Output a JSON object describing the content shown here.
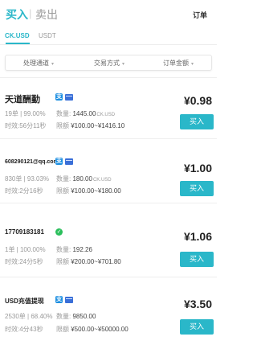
{
  "header": {
    "tab_buy": "买入",
    "tab_separator": "|",
    "tab_sell": "卖出",
    "orders": "订单"
  },
  "currency_tabs": [
    {
      "label": "CK.USD",
      "active": true
    },
    {
      "label": "USDT",
      "active": false
    }
  ],
  "filters": [
    {
      "label": "处理通道",
      "caret": "▾"
    },
    {
      "label": "交易方式",
      "caret": "▾"
    },
    {
      "label": "订单金额",
      "caret": "▾"
    }
  ],
  "labels": {
    "qty": "数量:",
    "limit": "限额",
    "unit": "CK.USD",
    "buy": "买入"
  },
  "colors": {
    "accent": "#2ab7c9",
    "alipay": "#1d8fe1",
    "bank_card": "#3a6fd8",
    "wechat": "#2bbf5c"
  },
  "listings": [
    {
      "merchant": "天道酬勤",
      "payment_icons": [
        "alipay-icon",
        "bank-card-icon"
      ],
      "stats": "19单 | 99.00%",
      "time": "时效:56分11秒",
      "qty": "1445.00",
      "limit": "¥100.00~¥1416.10",
      "price": "¥0.98"
    },
    {
      "merchant": "608290121@qq.com",
      "payment_icons": [
        "alipay-icon",
        "bank-card-icon"
      ],
      "stats": "830单 | 93.03%",
      "time": "时效:2分16秒",
      "qty": "180.00",
      "limit": "¥100.00~¥180.00",
      "price": "¥1.00"
    },
    {
      "merchant": "17709183181",
      "payment_icons": [
        "wechat-icon"
      ],
      "stats": "1单 | 100.00%",
      "time": "时效:24分5秒",
      "qty": "192.26",
      "limit": "¥200.00~¥701.80",
      "price": "¥1.06"
    },
    {
      "merchant": "USD充值提现",
      "payment_icons": [
        "alipay-icon",
        "bank-card-icon"
      ],
      "stats": "2530单 | 68.40%",
      "time": "时效:4分43秒",
      "qty": "9850.00",
      "limit": "¥500.00~¥50000.00",
      "price": "¥3.50"
    }
  ]
}
